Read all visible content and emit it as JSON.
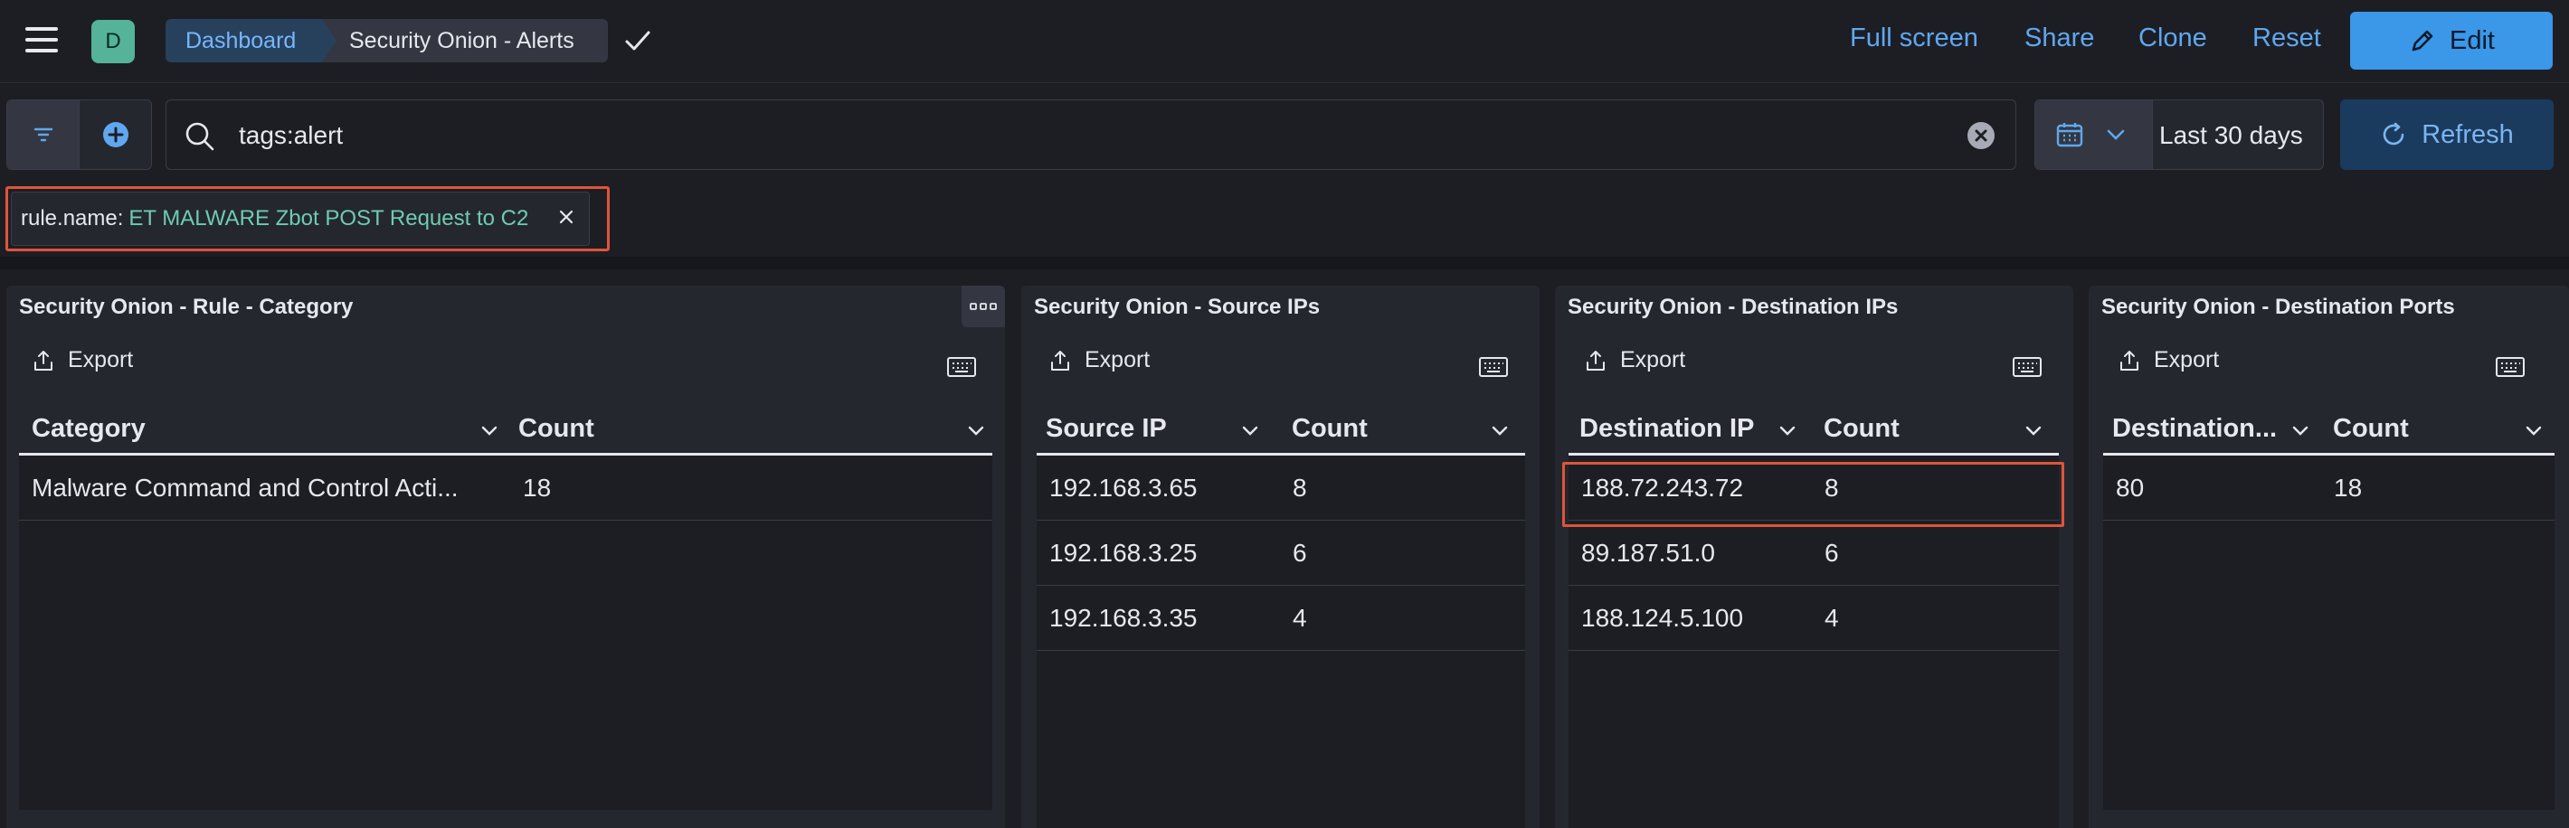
{
  "header": {
    "avatar_letter": "D",
    "breadcrumbs": [
      "Dashboard",
      "Security Onion - Alerts"
    ],
    "links": [
      "Full screen",
      "Share",
      "Clone",
      "Reset"
    ],
    "edit_label": "Edit"
  },
  "query": {
    "text": "tags:alert",
    "date_range": "Last 30 days",
    "refresh_label": "Refresh"
  },
  "filter_pill": {
    "field": "rule.name:",
    "value": "ET MALWARE Zbot POST Request to C2"
  },
  "panels": [
    {
      "title": "Security Onion - Rule - Category",
      "export_label": "Export",
      "columns": [
        "Category",
        "Count"
      ],
      "rows": [
        [
          "Malware Command and Control Acti...",
          "18"
        ]
      ]
    },
    {
      "title": "Security Onion - Source IPs",
      "export_label": "Export",
      "columns": [
        "Source IP",
        "Count"
      ],
      "rows": [
        [
          "192.168.3.65",
          "8"
        ],
        [
          "192.168.3.25",
          "6"
        ],
        [
          "192.168.3.35",
          "4"
        ]
      ]
    },
    {
      "title": "Security Onion - Destination IPs",
      "export_label": "Export",
      "columns": [
        "Destination IP",
        "Count"
      ],
      "rows": [
        [
          "188.72.243.72",
          "8"
        ],
        [
          "89.187.51.0",
          "6"
        ],
        [
          "188.124.5.100",
          "4"
        ]
      ]
    },
    {
      "title": "Security Onion - Destination Ports",
      "export_label": "Export",
      "columns": [
        "Destination...",
        "Count"
      ],
      "rows": [
        [
          "80",
          "18"
        ]
      ]
    }
  ],
  "colors": {
    "accent": "#3b97e8",
    "highlight": "#e0543a",
    "pill_value": "#6dccb1"
  }
}
